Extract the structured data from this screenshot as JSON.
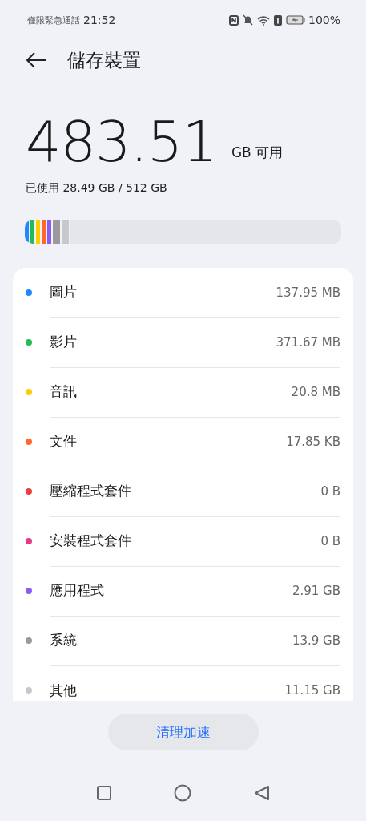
{
  "status_bar": {
    "carrier": "僅限緊急通話",
    "time": "21:52",
    "battery": "100%"
  },
  "header": {
    "title": "儲存裝置"
  },
  "summary": {
    "available": "483.51",
    "available_unit": "GB 可用",
    "used": "已使用 28.49 GB / 512 GB"
  },
  "storage_bar": [
    {
      "color": "#1e88ff"
    },
    {
      "color": "#22bb55"
    },
    {
      "color": "#ffcc00"
    },
    {
      "color": "#ff6a2a"
    },
    {
      "color": "#8c5cf0"
    },
    {
      "color": "#9a9a9e"
    },
    {
      "color": "#c8c8cc"
    }
  ],
  "categories": [
    {
      "name": "圖片",
      "size": "137.95 MB",
      "color": "#1e88ff"
    },
    {
      "name": "影片",
      "size": "371.67 MB",
      "color": "#22bb55"
    },
    {
      "name": "音訊",
      "size": "20.8 MB",
      "color": "#ffcc00"
    },
    {
      "name": "文件",
      "size": "17.85 KB",
      "color": "#ff6a2a"
    },
    {
      "name": "壓縮程式套件",
      "size": "0 B",
      "color": "#e84040"
    },
    {
      "name": "安裝程式套件",
      "size": "0 B",
      "color": "#e83a80"
    },
    {
      "name": "應用程式",
      "size": "2.91 GB",
      "color": "#8c5cf0"
    },
    {
      "name": "系統",
      "size": "13.9 GB",
      "color": "#9a9a9e"
    },
    {
      "name": "其他",
      "size": "11.15 GB",
      "color": "#c8c8cc"
    }
  ],
  "action_button": {
    "label": "清理加速"
  }
}
